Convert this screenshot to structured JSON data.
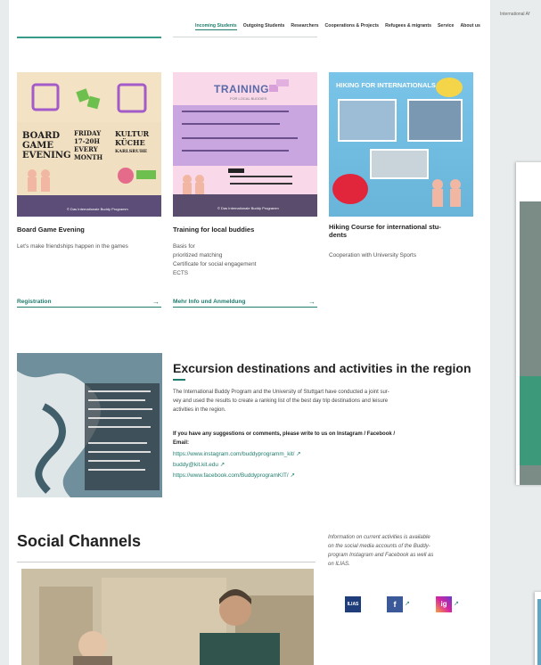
{
  "header": {
    "top_right": "International Af",
    "nav": [
      "Incoming Students",
      "Outgoing Students",
      "Researchers",
      "Cooperations & Projects",
      "Refugees & migrants",
      "Service",
      "About us"
    ],
    "active_nav": "Incoming Students"
  },
  "cards": [
    {
      "title": "Board Game Evening",
      "text": [
        "Let's make friendships happen in the games"
      ],
      "link": "Registration",
      "image_text": {
        "left": [
          "BOARD",
          "GAME",
          "EVENING"
        ],
        "mid": [
          "FRIDAY",
          "17-20H",
          "EVERY",
          "MONTH"
        ],
        "right": [
          "KULTUR",
          "KÜCHE",
          "KARLSRUHE"
        ],
        "credit": "© Das Internationale Buddy Programm"
      }
    },
    {
      "title": "Training for local buddies",
      "text": [
        "Basis for",
        "prioritized matching",
        "Certificate for social engagement",
        "ECTS"
      ],
      "link": "Mehr Info und Anmeldung",
      "image_text": {
        "heading": "TRAINING",
        "sub": "FOR LOCAL BUDDIES",
        "credit": "© Das Internationale Buddy Programm"
      }
    },
    {
      "title": "Hiking Course for international students",
      "title_lines": [
        "Hiking Course for international stu-",
        "dents"
      ],
      "text": [
        "Cooperation with University Sports"
      ],
      "link": "",
      "image_text": {
        "heading": "HIKING FOR INTERNATIONALS"
      }
    }
  ],
  "excursion": {
    "title": "Excursion destinations and activities in the region",
    "paragraph_lines": [
      "The International Buddy Program and the University of Stuttgart have conducted a joint sur-",
      "vey and used the results to create a ranking list of the best day trip destinations and leisure",
      "activities in the region."
    ],
    "contact_lines": [
      "If you have any suggestions or comments, please write to us on Instagram / Facebook /",
      "Email:"
    ],
    "links": [
      "https://www.instagram.com/buddyprogramm_kit/",
      "buddy@kit.kit.edu",
      "https://www.facebook.com/BuddyprogramKIT/"
    ]
  },
  "social": {
    "title": "Social Channels",
    "info_lines": [
      "Information on current activities is available",
      "on the social media accounts of the Buddy-",
      "program Instagram and Facebook as well as",
      "on ILIAS."
    ],
    "icons": [
      "ILIAS",
      "f",
      "ig"
    ]
  },
  "colors": {
    "accent": "#207d6d",
    "facebook": "#3b5998",
    "instagram": "#d6249f",
    "ilias": "#1f3d7a"
  }
}
